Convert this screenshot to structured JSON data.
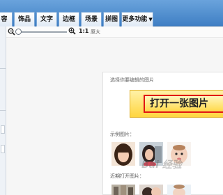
{
  "tabs": [
    {
      "label": "容"
    },
    {
      "label": "饰品"
    },
    {
      "label": "文字"
    },
    {
      "label": "边框"
    },
    {
      "label": "场景"
    },
    {
      "label": "拼图"
    },
    {
      "label": "更多功能"
    }
  ],
  "zoom": {
    "ratio_label": "1:1",
    "fit_label": "原大"
  },
  "open_panel": {
    "prompt": "选择你要编辑的图片",
    "open_button": "打开一张图片",
    "samples_title": "示例图片：",
    "recent_title": "近期打开图片："
  },
  "watermark": "Bai 经验"
}
